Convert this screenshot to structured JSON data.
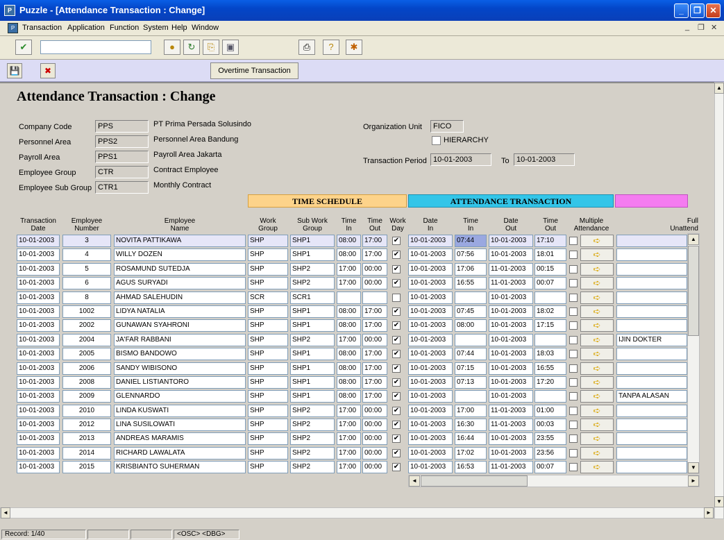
{
  "window": {
    "title": "Puzzle - [Attendance Transaction : Change]"
  },
  "menu": [
    "Transaction",
    "Application",
    "Function",
    "System",
    "Help",
    "Window"
  ],
  "app_toolbar": {
    "overtime_label": "Overtime Transaction"
  },
  "page_title": "Attendance Transaction : Change",
  "header": {
    "company_code_label": "Company Code",
    "company_code": "PPS",
    "company_name": "PT Prima Persada Solusindo",
    "personnel_area_label": "Personnel Area",
    "personnel_area": "PPS2",
    "personnel_area_name": "Personnel Area Bandung",
    "payroll_area_label": "Payroll Area",
    "payroll_area": "PPS1",
    "payroll_area_name": "Payroll Area Jakarta",
    "employee_group_label": "Employee Group",
    "employee_group": "CTR",
    "employee_group_name": "Contract Employee",
    "employee_sub_group_label": "Employee Sub Group",
    "employee_sub_group": "CTR1",
    "employee_sub_group_name": "Monthly Contract",
    "org_unit_label": "Organization Unit",
    "org_unit": "FICO",
    "hierarchy_label": "HIERARCHY",
    "period_label": "Transaction Period",
    "period_from": "10-01-2003",
    "to_label": "To",
    "period_to": "10-01-2003"
  },
  "sections": {
    "time_schedule": "TIME SCHEDULE",
    "attendance": "ATTENDANCE TRANSACTION"
  },
  "columns": {
    "trans_date": [
      "Transaction",
      "Date"
    ],
    "emp_no": [
      "Employee",
      "Number"
    ],
    "emp_name": [
      "Employee",
      "Name"
    ],
    "work_group": [
      "Work",
      "Group"
    ],
    "sub_group": [
      "Sub Work",
      "Group"
    ],
    "time_in": [
      "Time",
      "In"
    ],
    "time_out": [
      "Time",
      "Out"
    ],
    "work_day": [
      "Work",
      "Day"
    ],
    "date_in": [
      "Date",
      "In"
    ],
    "att_time_in": [
      "Time",
      "In"
    ],
    "date_out": [
      "Date",
      "Out"
    ],
    "att_time_out": [
      "Time",
      "Out"
    ],
    "multiple": [
      "Multiple",
      "Attendance"
    ],
    "full_unattend": [
      "Full",
      "Unattend"
    ]
  },
  "rows": [
    {
      "date": "10-01-2003",
      "no": "3",
      "name": "NOVITA PATTIKAWA",
      "wg": "SHP",
      "swg": "SHP1",
      "tin": "08:00",
      "tout": "17:00",
      "wd": true,
      "din": "10-01-2003",
      "ain": "07:44",
      "dout": "10-01-2003",
      "aout": "17:10",
      "note": ""
    },
    {
      "date": "10-01-2003",
      "no": "4",
      "name": "WILLY DOZEN",
      "wg": "SHP",
      "swg": "SHP1",
      "tin": "08:00",
      "tout": "17:00",
      "wd": true,
      "din": "10-01-2003",
      "ain": "07:56",
      "dout": "10-01-2003",
      "aout": "18:01",
      "note": ""
    },
    {
      "date": "10-01-2003",
      "no": "5",
      "name": "ROSAMUND SUTEDJA",
      "wg": "SHP",
      "swg": "SHP2",
      "tin": "17:00",
      "tout": "00:00",
      "wd": true,
      "din": "10-01-2003",
      "ain": "17:06",
      "dout": "11-01-2003",
      "aout": "00:15",
      "note": ""
    },
    {
      "date": "10-01-2003",
      "no": "6",
      "name": "AGUS SURYADI",
      "wg": "SHP",
      "swg": "SHP2",
      "tin": "17:00",
      "tout": "00:00",
      "wd": true,
      "din": "10-01-2003",
      "ain": "16:55",
      "dout": "11-01-2003",
      "aout": "00:07",
      "note": ""
    },
    {
      "date": "10-01-2003",
      "no": "8",
      "name": "AHMAD SALEHUDIN",
      "wg": "SCR",
      "swg": "SCR1",
      "tin": "",
      "tout": "",
      "wd": false,
      "din": "10-01-2003",
      "ain": "",
      "dout": "10-01-2003",
      "aout": "",
      "note": ""
    },
    {
      "date": "10-01-2003",
      "no": "1002",
      "name": "LIDYA NATALIA",
      "wg": "SHP",
      "swg": "SHP1",
      "tin": "08:00",
      "tout": "17:00",
      "wd": true,
      "din": "10-01-2003",
      "ain": "07:45",
      "dout": "10-01-2003",
      "aout": "18:02",
      "note": ""
    },
    {
      "date": "10-01-2003",
      "no": "2002",
      "name": "GUNAWAN SYAHRONI",
      "wg": "SHP",
      "swg": "SHP1",
      "tin": "08:00",
      "tout": "17:00",
      "wd": true,
      "din": "10-01-2003",
      "ain": "08:00",
      "dout": "10-01-2003",
      "aout": "17:15",
      "note": ""
    },
    {
      "date": "10-01-2003",
      "no": "2004",
      "name": "JA'FAR RABBANI",
      "wg": "SHP",
      "swg": "SHP2",
      "tin": "17:00",
      "tout": "00:00",
      "wd": true,
      "din": "10-01-2003",
      "ain": "",
      "dout": "10-01-2003",
      "aout": "",
      "note": "IJIN DOKTER"
    },
    {
      "date": "10-01-2003",
      "no": "2005",
      "name": "BISMO BANDOWO",
      "wg": "SHP",
      "swg": "SHP1",
      "tin": "08:00",
      "tout": "17:00",
      "wd": true,
      "din": "10-01-2003",
      "ain": "07:44",
      "dout": "10-01-2003",
      "aout": "18:03",
      "note": ""
    },
    {
      "date": "10-01-2003",
      "no": "2006",
      "name": "SANDY WIBISONO",
      "wg": "SHP",
      "swg": "SHP1",
      "tin": "08:00",
      "tout": "17:00",
      "wd": true,
      "din": "10-01-2003",
      "ain": "07:15",
      "dout": "10-01-2003",
      "aout": "16:55",
      "note": ""
    },
    {
      "date": "10-01-2003",
      "no": "2008",
      "name": "DANIEL LISTIANTORO",
      "wg": "SHP",
      "swg": "SHP1",
      "tin": "08:00",
      "tout": "17:00",
      "wd": true,
      "din": "10-01-2003",
      "ain": "07:13",
      "dout": "10-01-2003",
      "aout": "17:20",
      "note": ""
    },
    {
      "date": "10-01-2003",
      "no": "2009",
      "name": "GLENNARDO",
      "wg": "SHP",
      "swg": "SHP1",
      "tin": "08:00",
      "tout": "17:00",
      "wd": true,
      "din": "10-01-2003",
      "ain": "",
      "dout": "10-01-2003",
      "aout": "",
      "note": "TANPA ALASAN"
    },
    {
      "date": "10-01-2003",
      "no": "2010",
      "name": "LINDA KUSWATI",
      "wg": "SHP",
      "swg": "SHP2",
      "tin": "17:00",
      "tout": "00:00",
      "wd": true,
      "din": "10-01-2003",
      "ain": "17:00",
      "dout": "11-01-2003",
      "aout": "01:00",
      "note": ""
    },
    {
      "date": "10-01-2003",
      "no": "2012",
      "name": "LINA SUSILOWATI",
      "wg": "SHP",
      "swg": "SHP2",
      "tin": "17:00",
      "tout": "00:00",
      "wd": true,
      "din": "10-01-2003",
      "ain": "16:30",
      "dout": "11-01-2003",
      "aout": "00:03",
      "note": ""
    },
    {
      "date": "10-01-2003",
      "no": "2013",
      "name": "ANDREAS MARAMIS",
      "wg": "SHP",
      "swg": "SHP2",
      "tin": "17:00",
      "tout": "00:00",
      "wd": true,
      "din": "10-01-2003",
      "ain": "16:44",
      "dout": "10-01-2003",
      "aout": "23:55",
      "note": ""
    },
    {
      "date": "10-01-2003",
      "no": "2014",
      "name": "RICHARD LAWALATA",
      "wg": "SHP",
      "swg": "SHP2",
      "tin": "17:00",
      "tout": "00:00",
      "wd": true,
      "din": "10-01-2003",
      "ain": "17:02",
      "dout": "10-01-2003",
      "aout": "23:56",
      "note": ""
    },
    {
      "date": "10-01-2003",
      "no": "2015",
      "name": "KRISBIANTO SUHERMAN",
      "wg": "SHP",
      "swg": "SHP2",
      "tin": "17:00",
      "tout": "00:00",
      "wd": true,
      "din": "10-01-2003",
      "ain": "16:53",
      "dout": "11-01-2003",
      "aout": "00:07",
      "note": ""
    }
  ],
  "status": {
    "record": "Record: 1/40",
    "mode": "<OSC> <DBG>"
  },
  "colors": {
    "time_schedule_bg": "#fdd38a",
    "attendance_bg": "#33c5e8",
    "unattend_bg": "#f47cf0",
    "selected_row": "#e6e6f8",
    "highlight": "#9aa8e0"
  }
}
